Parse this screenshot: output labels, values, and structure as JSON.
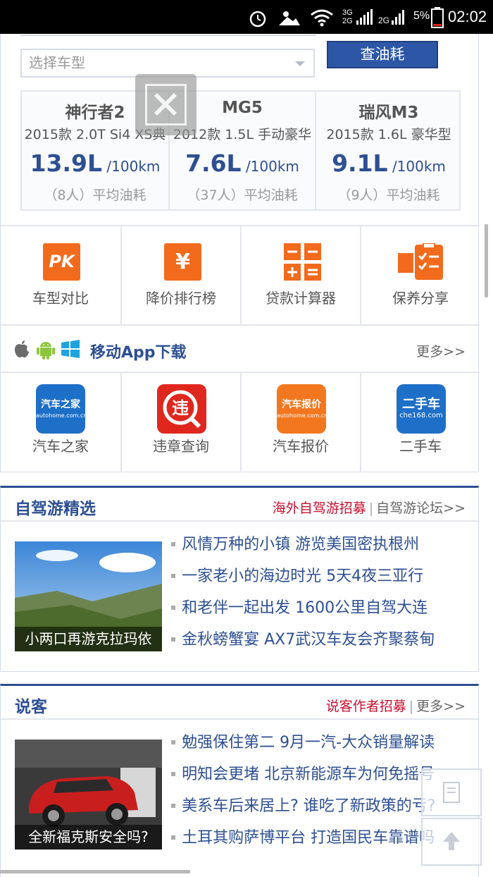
{
  "status_bar": {
    "battery": "5%",
    "time": "02:02",
    "net1": "3G",
    "net2": "2G",
    "net3": "2G"
  },
  "search": {
    "select_placeholder": "选择车型",
    "button": "查油耗"
  },
  "cars": [
    {
      "name": "神行者2",
      "spec": "2015款 2.0T Si4 XS典",
      "fuel": "13.9L",
      "unit": "/100km",
      "avg": "（8人）平均油耗"
    },
    {
      "name": "MG5",
      "spec": "2012款 1.5L 手动豪华",
      "fuel": "7.6L",
      "unit": "/100km",
      "avg": "（37人）平均油耗"
    },
    {
      "name": "瑞风M3",
      "spec": "2015款 1.6L 豪华型",
      "fuel": "9.1L",
      "unit": "/100km",
      "avg": "（9人）平均油耗"
    }
  ],
  "tools": [
    {
      "icon": "pk-icon",
      "glyph": "PK",
      "label": "车型对比"
    },
    {
      "icon": "yen-icon",
      "glyph": "¥",
      "label": "降价排行榜"
    },
    {
      "icon": "calculator-icon",
      "glyph": "",
      "label": "贷款计算器"
    },
    {
      "icon": "checklist-icon",
      "glyph": "",
      "label": "保养分享"
    }
  ],
  "app_bar": {
    "title": "移动App下载",
    "more": "更多>>"
  },
  "apps": [
    {
      "label": "汽车之家",
      "icon_text": "汽车之家",
      "icon_sub": "autohome.com.cn",
      "color": "#1e6fc7"
    },
    {
      "label": "违章查询",
      "icon_text": "违",
      "icon_sub": "",
      "color": "#e0271e"
    },
    {
      "label": "汽车报价",
      "icon_text": "汽车报价",
      "icon_sub": "autohome.com.cn",
      "color": "#f2771e"
    },
    {
      "label": "二手车",
      "icon_text": "二手车",
      "icon_sub": "che168.com",
      "color": "#1e6fc7"
    }
  ],
  "travel": {
    "title": "自驾游精选",
    "link_red": "海外自驾游招募",
    "link_more": "自驾游论坛>>",
    "caption": "小两口再游克拉玛依",
    "items": [
      "风情万种的小镇 游览美国密执根州",
      "一家老小的海边时光 5天4夜三亚行",
      "和老伴一起出发 1600公里自驾大连",
      "金秋螃蟹宴 AX7武汉车友会齐聚蔡甸"
    ]
  },
  "talk": {
    "title": "说客",
    "link_red": "说客作者招募",
    "link_more": "更多>>",
    "caption": "全新福克斯安全吗?",
    "items": [
      "勉强保住第二 9月一汽-大众销量解读",
      "明知会更堵 北京新能源车为何免摇号",
      "美系车后来居上? 谁吃了新政策的亏?",
      "土耳其购萨博平台 打造国民车靠谱吗"
    ]
  }
}
